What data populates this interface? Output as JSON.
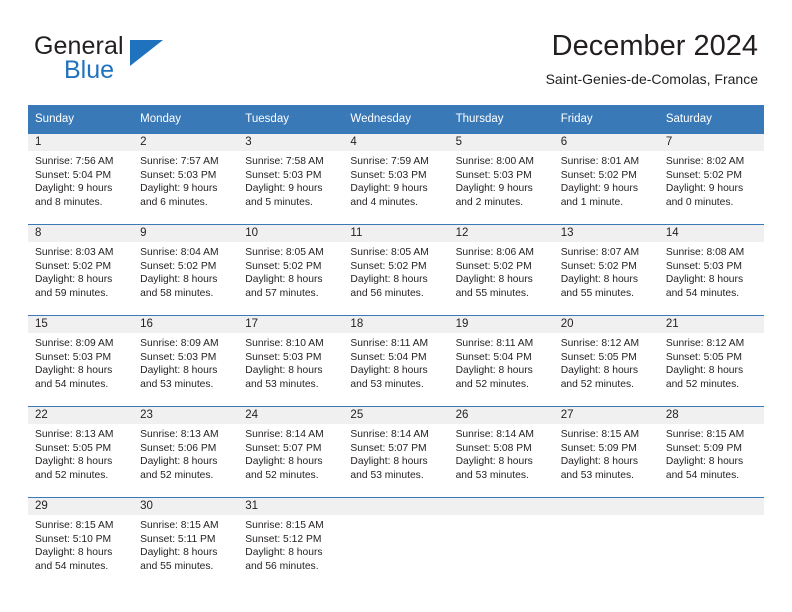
{
  "brand": {
    "name_top": "General",
    "name_bottom": "Blue",
    "flag_icon": "blue-triangle-flag-icon",
    "accent_color": "#1f72bd"
  },
  "header": {
    "title": "December 2024",
    "subtitle": "Saint-Genies-de-Comolas, France"
  },
  "theme": {
    "header_row_bg": "#3a79b8",
    "daynum_band_bg": "#f0f0f0",
    "text_color": "#231f20"
  },
  "weekday_headers": [
    "Sunday",
    "Monday",
    "Tuesday",
    "Wednesday",
    "Thursday",
    "Friday",
    "Saturday"
  ],
  "weeks": [
    [
      {
        "day": "1",
        "sunrise": "Sunrise: 7:56 AM",
        "sunset": "Sunset: 5:04 PM",
        "daylight_line1": "Daylight: 9 hours",
        "daylight_line2": "and 8 minutes."
      },
      {
        "day": "2",
        "sunrise": "Sunrise: 7:57 AM",
        "sunset": "Sunset: 5:03 PM",
        "daylight_line1": "Daylight: 9 hours",
        "daylight_line2": "and 6 minutes."
      },
      {
        "day": "3",
        "sunrise": "Sunrise: 7:58 AM",
        "sunset": "Sunset: 5:03 PM",
        "daylight_line1": "Daylight: 9 hours",
        "daylight_line2": "and 5 minutes."
      },
      {
        "day": "4",
        "sunrise": "Sunrise: 7:59 AM",
        "sunset": "Sunset: 5:03 PM",
        "daylight_line1": "Daylight: 9 hours",
        "daylight_line2": "and 4 minutes."
      },
      {
        "day": "5",
        "sunrise": "Sunrise: 8:00 AM",
        "sunset": "Sunset: 5:03 PM",
        "daylight_line1": "Daylight: 9 hours",
        "daylight_line2": "and 2 minutes."
      },
      {
        "day": "6",
        "sunrise": "Sunrise: 8:01 AM",
        "sunset": "Sunset: 5:02 PM",
        "daylight_line1": "Daylight: 9 hours",
        "daylight_line2": "and 1 minute."
      },
      {
        "day": "7",
        "sunrise": "Sunrise: 8:02 AM",
        "sunset": "Sunset: 5:02 PM",
        "daylight_line1": "Daylight: 9 hours",
        "daylight_line2": "and 0 minutes."
      }
    ],
    [
      {
        "day": "8",
        "sunrise": "Sunrise: 8:03 AM",
        "sunset": "Sunset: 5:02 PM",
        "daylight_line1": "Daylight: 8 hours",
        "daylight_line2": "and 59 minutes."
      },
      {
        "day": "9",
        "sunrise": "Sunrise: 8:04 AM",
        "sunset": "Sunset: 5:02 PM",
        "daylight_line1": "Daylight: 8 hours",
        "daylight_line2": "and 58 minutes."
      },
      {
        "day": "10",
        "sunrise": "Sunrise: 8:05 AM",
        "sunset": "Sunset: 5:02 PM",
        "daylight_line1": "Daylight: 8 hours",
        "daylight_line2": "and 57 minutes."
      },
      {
        "day": "11",
        "sunrise": "Sunrise: 8:05 AM",
        "sunset": "Sunset: 5:02 PM",
        "daylight_line1": "Daylight: 8 hours",
        "daylight_line2": "and 56 minutes."
      },
      {
        "day": "12",
        "sunrise": "Sunrise: 8:06 AM",
        "sunset": "Sunset: 5:02 PM",
        "daylight_line1": "Daylight: 8 hours",
        "daylight_line2": "and 55 minutes."
      },
      {
        "day": "13",
        "sunrise": "Sunrise: 8:07 AM",
        "sunset": "Sunset: 5:02 PM",
        "daylight_line1": "Daylight: 8 hours",
        "daylight_line2": "and 55 minutes."
      },
      {
        "day": "14",
        "sunrise": "Sunrise: 8:08 AM",
        "sunset": "Sunset: 5:03 PM",
        "daylight_line1": "Daylight: 8 hours",
        "daylight_line2": "and 54 minutes."
      }
    ],
    [
      {
        "day": "15",
        "sunrise": "Sunrise: 8:09 AM",
        "sunset": "Sunset: 5:03 PM",
        "daylight_line1": "Daylight: 8 hours",
        "daylight_line2": "and 54 minutes."
      },
      {
        "day": "16",
        "sunrise": "Sunrise: 8:09 AM",
        "sunset": "Sunset: 5:03 PM",
        "daylight_line1": "Daylight: 8 hours",
        "daylight_line2": "and 53 minutes."
      },
      {
        "day": "17",
        "sunrise": "Sunrise: 8:10 AM",
        "sunset": "Sunset: 5:03 PM",
        "daylight_line1": "Daylight: 8 hours",
        "daylight_line2": "and 53 minutes."
      },
      {
        "day": "18",
        "sunrise": "Sunrise: 8:11 AM",
        "sunset": "Sunset: 5:04 PM",
        "daylight_line1": "Daylight: 8 hours",
        "daylight_line2": "and 53 minutes."
      },
      {
        "day": "19",
        "sunrise": "Sunrise: 8:11 AM",
        "sunset": "Sunset: 5:04 PM",
        "daylight_line1": "Daylight: 8 hours",
        "daylight_line2": "and 52 minutes."
      },
      {
        "day": "20",
        "sunrise": "Sunrise: 8:12 AM",
        "sunset": "Sunset: 5:05 PM",
        "daylight_line1": "Daylight: 8 hours",
        "daylight_line2": "and 52 minutes."
      },
      {
        "day": "21",
        "sunrise": "Sunrise: 8:12 AM",
        "sunset": "Sunset: 5:05 PM",
        "daylight_line1": "Daylight: 8 hours",
        "daylight_line2": "and 52 minutes."
      }
    ],
    [
      {
        "day": "22",
        "sunrise": "Sunrise: 8:13 AM",
        "sunset": "Sunset: 5:05 PM",
        "daylight_line1": "Daylight: 8 hours",
        "daylight_line2": "and 52 minutes."
      },
      {
        "day": "23",
        "sunrise": "Sunrise: 8:13 AM",
        "sunset": "Sunset: 5:06 PM",
        "daylight_line1": "Daylight: 8 hours",
        "daylight_line2": "and 52 minutes."
      },
      {
        "day": "24",
        "sunrise": "Sunrise: 8:14 AM",
        "sunset": "Sunset: 5:07 PM",
        "daylight_line1": "Daylight: 8 hours",
        "daylight_line2": "and 52 minutes."
      },
      {
        "day": "25",
        "sunrise": "Sunrise: 8:14 AM",
        "sunset": "Sunset: 5:07 PM",
        "daylight_line1": "Daylight: 8 hours",
        "daylight_line2": "and 53 minutes."
      },
      {
        "day": "26",
        "sunrise": "Sunrise: 8:14 AM",
        "sunset": "Sunset: 5:08 PM",
        "daylight_line1": "Daylight: 8 hours",
        "daylight_line2": "and 53 minutes."
      },
      {
        "day": "27",
        "sunrise": "Sunrise: 8:15 AM",
        "sunset": "Sunset: 5:09 PM",
        "daylight_line1": "Daylight: 8 hours",
        "daylight_line2": "and 53 minutes."
      },
      {
        "day": "28",
        "sunrise": "Sunrise: 8:15 AM",
        "sunset": "Sunset: 5:09 PM",
        "daylight_line1": "Daylight: 8 hours",
        "daylight_line2": "and 54 minutes."
      }
    ],
    [
      {
        "day": "29",
        "sunrise": "Sunrise: 8:15 AM",
        "sunset": "Sunset: 5:10 PM",
        "daylight_line1": "Daylight: 8 hours",
        "daylight_line2": "and 54 minutes."
      },
      {
        "day": "30",
        "sunrise": "Sunrise: 8:15 AM",
        "sunset": "Sunset: 5:11 PM",
        "daylight_line1": "Daylight: 8 hours",
        "daylight_line2": "and 55 minutes."
      },
      {
        "day": "31",
        "sunrise": "Sunrise: 8:15 AM",
        "sunset": "Sunset: 5:12 PM",
        "daylight_line1": "Daylight: 8 hours",
        "daylight_line2": "and 56 minutes."
      },
      {
        "day": "",
        "sunrise": "",
        "sunset": "",
        "daylight_line1": "",
        "daylight_line2": ""
      },
      {
        "day": "",
        "sunrise": "",
        "sunset": "",
        "daylight_line1": "",
        "daylight_line2": ""
      },
      {
        "day": "",
        "sunrise": "",
        "sunset": "",
        "daylight_line1": "",
        "daylight_line2": ""
      },
      {
        "day": "",
        "sunrise": "",
        "sunset": "",
        "daylight_line1": "",
        "daylight_line2": ""
      }
    ]
  ]
}
